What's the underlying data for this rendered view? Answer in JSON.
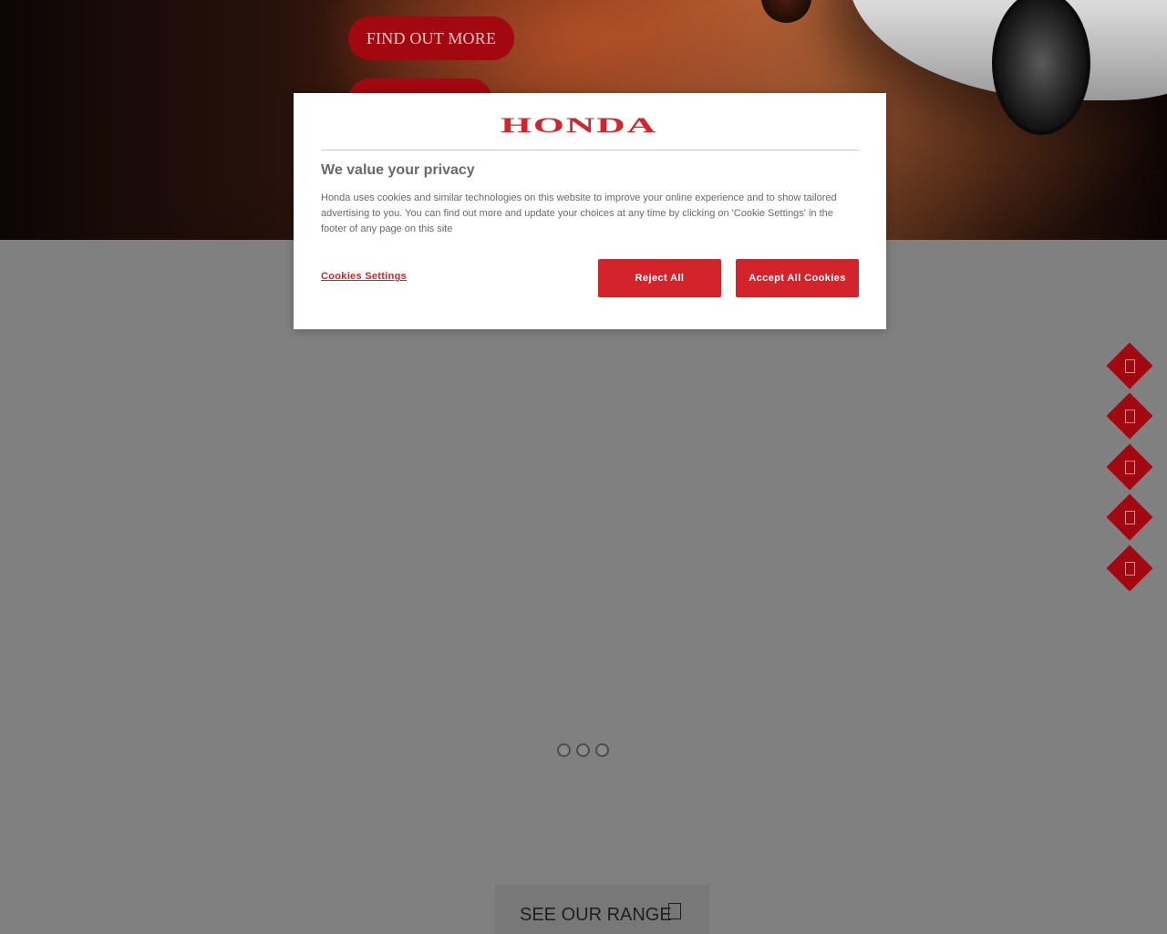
{
  "hero": {
    "primary_button": "FIND OUT MORE",
    "secondary_button": ""
  },
  "side_nav": {
    "items": [
      {
        "icon": "nav-icon-1"
      },
      {
        "icon": "nav-icon-2"
      },
      {
        "icon": "nav-icon-3"
      },
      {
        "icon": "nav-icon-4"
      },
      {
        "icon": "nav-icon-5"
      }
    ]
  },
  "main": {
    "range_button": "SEE OUR RANGE"
  },
  "cookie_modal": {
    "logo_text": "HONDA",
    "title": "We value your privacy",
    "body": "Honda uses cookies and similar technologies on this website to improve your online experience and to show tailored advertising to you. You can find out more and update your choices at any time by clicking on 'Cookie Settings' in the footer of any page on this site",
    "settings_link": "Cookies Settings",
    "reject_button": "Reject All",
    "accept_button": "Accept All Cookies"
  },
  "colors": {
    "brand_red": "#d3242b",
    "dark_red": "#a3070f",
    "overlay_gray": "#808080"
  }
}
